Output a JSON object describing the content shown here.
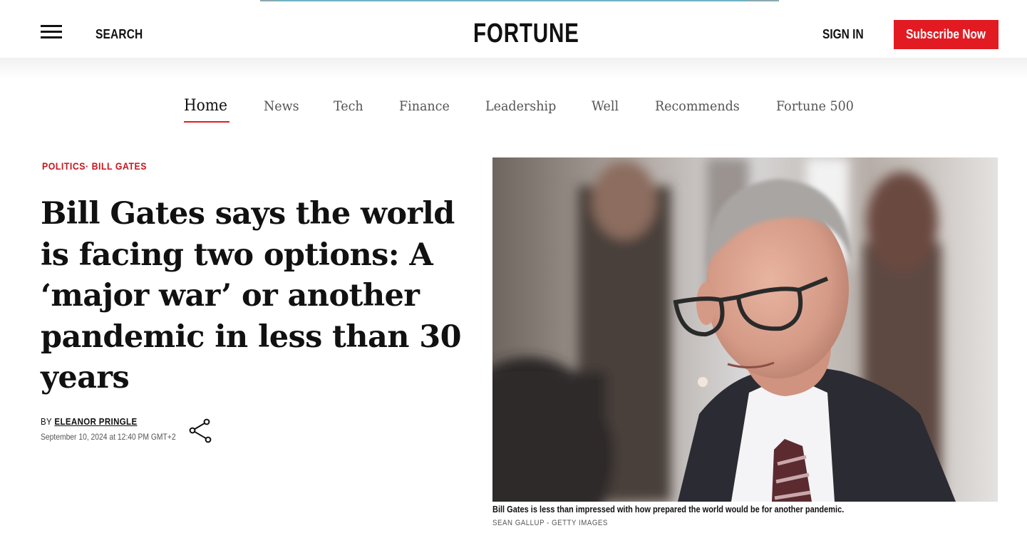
{
  "header": {
    "logo": "FORTUNE",
    "search_label": "SEARCH",
    "signin_label": "SIGN IN",
    "subscribe_label": "Subscribe Now",
    "accent_color": "#e21b23"
  },
  "nav": {
    "items": [
      {
        "label": "Home",
        "active": true
      },
      {
        "label": "News"
      },
      {
        "label": "Tech"
      },
      {
        "label": "Finance"
      },
      {
        "label": "Leadership"
      },
      {
        "label": "Well"
      },
      {
        "label": "Recommends"
      },
      {
        "label": "Fortune 500"
      }
    ]
  },
  "article": {
    "kicker": {
      "tag1": "POLITICS",
      "separator": "·",
      "tag2": "BILL GATES"
    },
    "headline": "Bill Gates says the world is facing two options: A ‘major war’ or another pandemic in less than 30 years",
    "by_label": "BY",
    "author": "ELEANOR PRINGLE",
    "date": "September 10, 2024 at 12:40 PM GMT+2",
    "share_icon": "share-icon"
  },
  "image": {
    "caption": "Bill Gates is less than impressed with how prepared the world would be for another pandemic.",
    "credit": "SEAN GALLUP - GETTY IMAGES"
  }
}
